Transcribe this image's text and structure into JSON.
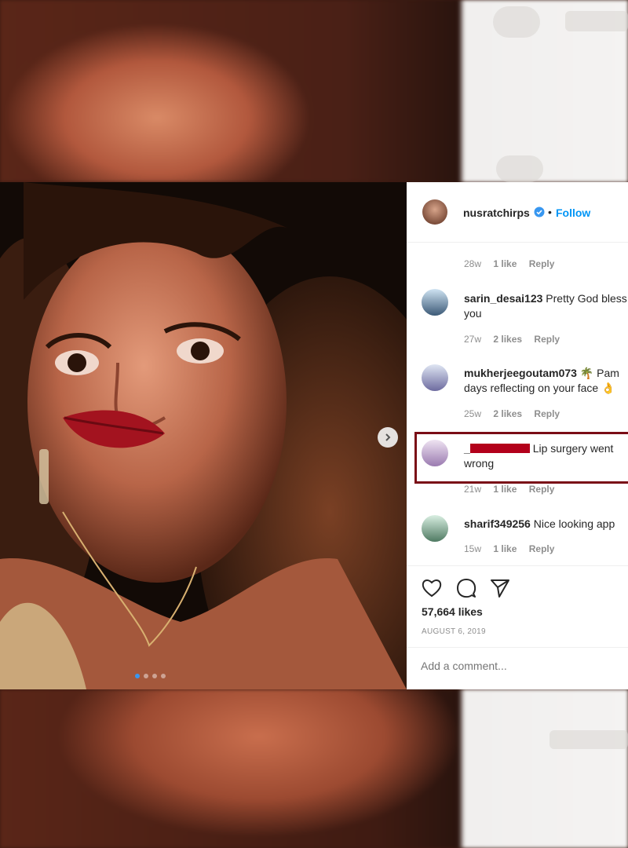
{
  "post": {
    "username": "nusratchirps",
    "follow_label": "Follow",
    "separator": "•",
    "likes": "57,664 likes",
    "date": "AUGUST 6, 2019",
    "comment_placeholder": "Add a comment..."
  },
  "comments": [
    {
      "time": "28w",
      "likes": "1 like",
      "reply": "Reply"
    },
    {
      "user": "sarin_desai123",
      "text": "Pretty God bless you",
      "time": "27w",
      "likes": "2 likes",
      "reply": "Reply"
    },
    {
      "user": "mukherjeegoutam073",
      "text": "🌴 Pam days reflecting on your face 👌",
      "time": "25w",
      "likes": "2 likes",
      "reply": "Reply"
    },
    {
      "user": "_",
      "text": "Lip surgery went wrong",
      "time": "21w",
      "likes": "1 like",
      "reply": "Reply"
    },
    {
      "user": "sharif349256",
      "text": "Nice looking app",
      "time": "15w",
      "likes": "1 like",
      "reply": "Reply"
    }
  ],
  "carousel": {
    "count": 4,
    "active": 0
  },
  "colors": {
    "link_blue": "#0095f6",
    "verified_blue": "#3897f0",
    "highlight_border": "#7a0d16",
    "redaction": "#b3001b"
  },
  "icons": [
    "verified-badge-icon",
    "next-arrow-icon",
    "heart-icon",
    "comment-icon",
    "share-icon"
  ]
}
